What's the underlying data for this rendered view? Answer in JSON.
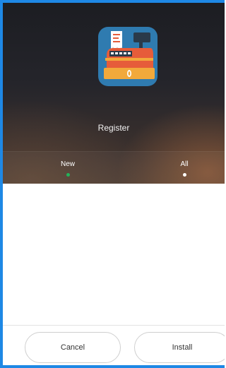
{
  "app": {
    "name": "Register",
    "icon": "cash-register-icon"
  },
  "tabs": [
    {
      "label": "New",
      "indicator_color": "#22b35a",
      "selected": true
    },
    {
      "label": "All",
      "indicator_color": "#ffffff",
      "selected": false
    }
  ],
  "actions": {
    "cancel_label": "Cancel",
    "install_label": "Install"
  },
  "colors": {
    "frame_border": "#1e88e5",
    "icon_background": "#2f7bb0",
    "icon_body": "#e65c3a",
    "icon_drawer": "#f2a93b"
  }
}
